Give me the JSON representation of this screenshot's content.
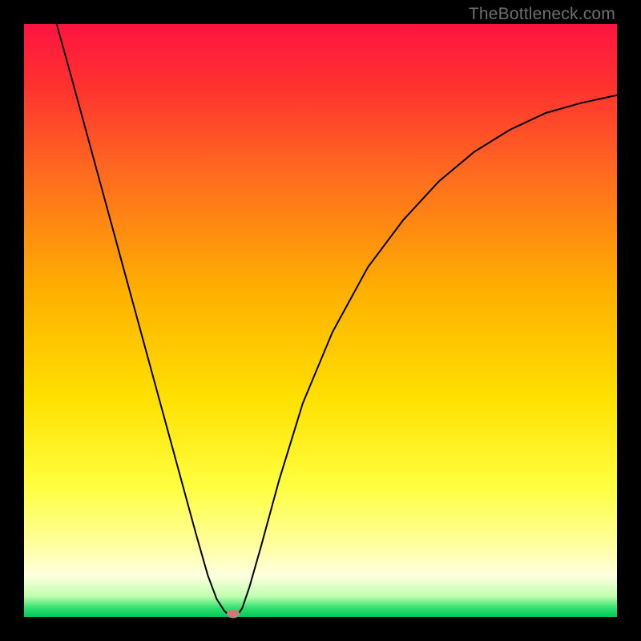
{
  "watermark": "TheBottleneck.com",
  "chart_data": {
    "type": "line",
    "title": "",
    "xlabel": "",
    "ylabel": "",
    "xlim": [
      0,
      1
    ],
    "ylim": [
      0,
      1
    ],
    "background_gradient": {
      "stops": [
        {
          "offset": 0.0,
          "color": "#ff1440"
        },
        {
          "offset": 0.1,
          "color": "#ff3030"
        },
        {
          "offset": 0.25,
          "color": "#ff6a20"
        },
        {
          "offset": 0.45,
          "color": "#ffb000"
        },
        {
          "offset": 0.63,
          "color": "#ffe000"
        },
        {
          "offset": 0.78,
          "color": "#ffff40"
        },
        {
          "offset": 0.88,
          "color": "#ffffa0"
        },
        {
          "offset": 0.93,
          "color": "#ffffe0"
        },
        {
          "offset": 0.965,
          "color": "#c0ffb0"
        },
        {
          "offset": 0.985,
          "color": "#30e070"
        },
        {
          "offset": 1.0,
          "color": "#00c855"
        }
      ]
    },
    "series": [
      {
        "name": "bottleneck-curve",
        "color": "#000000",
        "stroke_width": 2,
        "x": [
          0.055,
          0.08,
          0.11,
          0.14,
          0.17,
          0.2,
          0.23,
          0.26,
          0.29,
          0.31,
          0.325,
          0.338,
          0.346,
          0.352,
          0.355,
          0.36,
          0.368,
          0.38,
          0.4,
          0.43,
          0.47,
          0.52,
          0.58,
          0.64,
          0.7,
          0.76,
          0.82,
          0.88,
          0.94,
          1.0
        ],
        "y": [
          1.0,
          0.91,
          0.8,
          0.69,
          0.58,
          0.47,
          0.36,
          0.25,
          0.14,
          0.07,
          0.03,
          0.01,
          0.003,
          0.0,
          0.0,
          0.003,
          0.015,
          0.05,
          0.12,
          0.23,
          0.36,
          0.48,
          0.59,
          0.67,
          0.735,
          0.785,
          0.822,
          0.85,
          0.867,
          0.88
        ]
      }
    ],
    "annotations": [
      {
        "name": "min-marker",
        "x": 0.353,
        "y": 0.0,
        "color": "#c97a7a"
      }
    ]
  }
}
